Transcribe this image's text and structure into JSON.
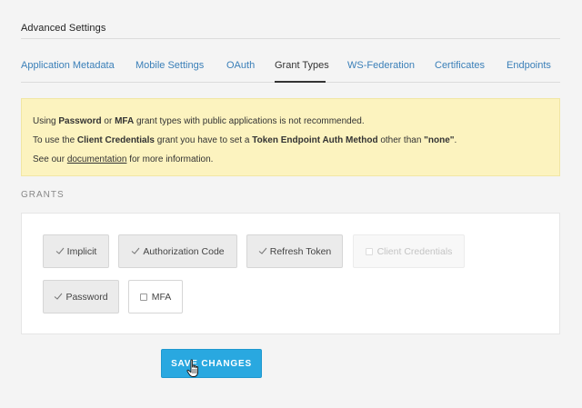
{
  "section": {
    "title": "Advanced Settings"
  },
  "tabs": [
    {
      "label": "Application Metadata",
      "active": false
    },
    {
      "label": "Mobile Settings",
      "active": false
    },
    {
      "label": "OAuth",
      "active": false
    },
    {
      "label": "Grant Types",
      "active": true
    },
    {
      "label": "WS-Federation",
      "active": false
    },
    {
      "label": "Certificates",
      "active": false
    },
    {
      "label": "Endpoints",
      "active": false
    }
  ],
  "alert": {
    "line1": {
      "pre": "Using ",
      "b1": "Password",
      "mid": " or ",
      "b2": "MFA",
      "post": " grant types with public applications is not recommended."
    },
    "line2": {
      "pre": "To use the ",
      "b1": "Client Credentials",
      "mid": " grant you have to set a ",
      "b2": "Token Endpoint Auth Method",
      "post": " other than ",
      "b3": "\"none\"",
      "end": "."
    },
    "line3": {
      "pre": "See our ",
      "link": "documentation",
      "post": " for more information."
    }
  },
  "grants": {
    "label": "GRANTS",
    "items": [
      {
        "label": "Implicit",
        "state": "checked"
      },
      {
        "label": "Authorization Code",
        "state": "checked"
      },
      {
        "label": "Refresh Token",
        "state": "checked"
      },
      {
        "label": "Client Credentials",
        "state": "disabled"
      },
      {
        "label": "Password",
        "state": "checked"
      },
      {
        "label": "MFA",
        "state": "unchecked"
      }
    ]
  },
  "actions": {
    "save_label": "SAVE CHANGES"
  },
  "colors": {
    "accent": "#29a8e0",
    "link": "#3a7fb8",
    "alert_bg": "#fcf3bf"
  },
  "icons": {
    "check": "check-icon",
    "cursor": "hand-pointer-icon"
  }
}
